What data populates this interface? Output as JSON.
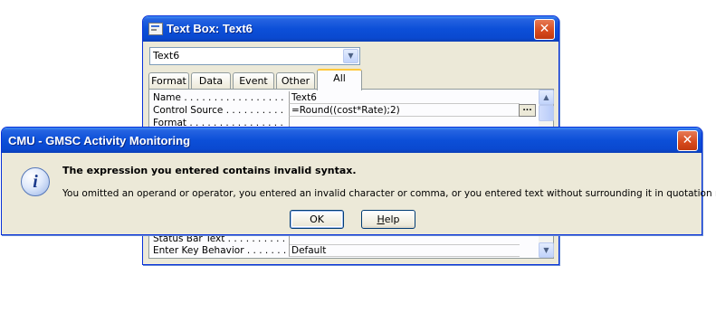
{
  "property_sheet": {
    "title": "Text Box: Text6",
    "object_selector": "Text6",
    "tabs": [
      "Format",
      "Data",
      "Event",
      "Other",
      "All"
    ],
    "active_tab": "All",
    "rows_top": [
      {
        "name": "Name . . . . . . . . . . . . . . . . .",
        "value": "Text6"
      },
      {
        "name": "Control Source . . . . . . . . . . .",
        "value": "=Round((cost*Rate);2)"
      },
      {
        "name": "Format . . . . . . . . . . . . . . . .",
        "value": ""
      }
    ],
    "rows_bottom": [
      {
        "name": "Status Bar Text . . . . . . . . . .",
        "value": ""
      },
      {
        "name": "Enter Key Behavior . . . . . . . .",
        "value": "Default"
      }
    ],
    "build_button_label": "..."
  },
  "message_box": {
    "title": "CMU - GMSC Activity Monitoring",
    "icon": "information-icon",
    "icon_glyph": "i",
    "main_text": "The expression you entered contains invalid syntax.",
    "detail_text": "You omitted an operand or operator, you entered an invalid character or comma, or you entered text without surrounding it in quotation marks.",
    "ok_label": "OK",
    "help_label_u": "H",
    "help_label_rest": "elp"
  },
  "glyphs": {
    "close": "✕",
    "chevron_down": "▼",
    "chevron_up": "▲"
  },
  "colors": {
    "titlebar": "#0a49d0",
    "dialog_bg": "#ece9d8",
    "close_button": "#d6491c"
  }
}
